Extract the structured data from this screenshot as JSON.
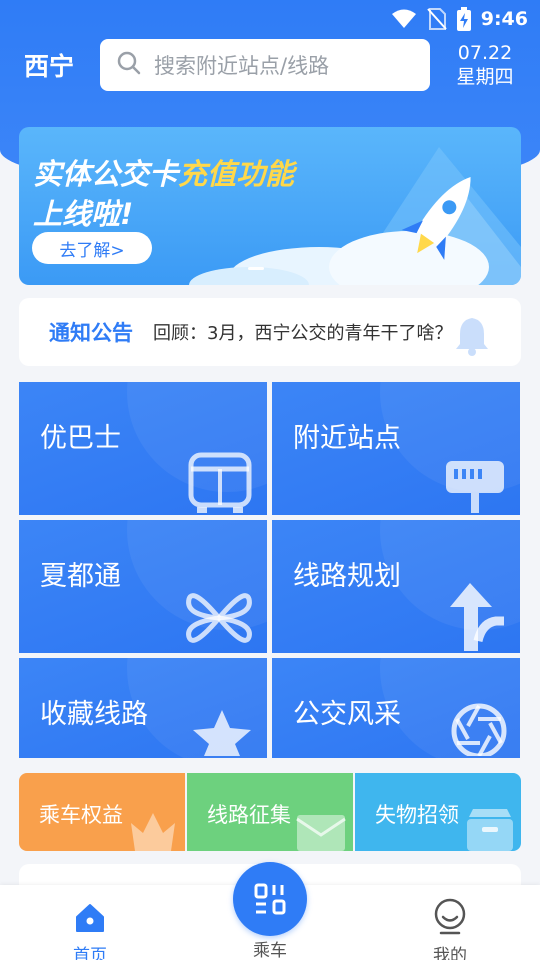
{
  "status_bar": {
    "time": "9:46"
  },
  "header": {
    "city": "西宁",
    "search_placeholder": "搜索附近站点/线路",
    "date": "07.22",
    "weekday": "星期四"
  },
  "banner": {
    "line1_prefix": "实体公交卡",
    "line1_highlight": "充值功能",
    "line2": "上线啦!",
    "button_label": "去了解>"
  },
  "notice": {
    "title": "通知公告",
    "text": "回顾：3月，西宁公交的青年干了啥？"
  },
  "tiles": [
    {
      "label": "优巴士",
      "icon": "bus-icon"
    },
    {
      "label": "附近站点",
      "icon": "bus-stop-sign-icon"
    },
    {
      "label": "夏都通",
      "icon": "clover-icon"
    },
    {
      "label": "线路规划",
      "icon": "route-arrow-icon"
    },
    {
      "label": "收藏线路",
      "icon": "star-icon"
    },
    {
      "label": "公交风采",
      "icon": "camera-aperture-icon"
    }
  ],
  "strip": [
    {
      "label": "乘车权益",
      "icon": "crown-icon",
      "color": "#f9a04c"
    },
    {
      "label": "线路征集",
      "icon": "envelope-icon",
      "color": "#6dd17e"
    },
    {
      "label": "失物招领",
      "icon": "box-icon",
      "color": "#3fb6ee"
    }
  ],
  "tabbar": {
    "home_label": "首页",
    "ride_label": "乘车",
    "me_label": "我的"
  },
  "colors": {
    "primary": "#2f7cf6",
    "highlight": "#ffd84a"
  }
}
